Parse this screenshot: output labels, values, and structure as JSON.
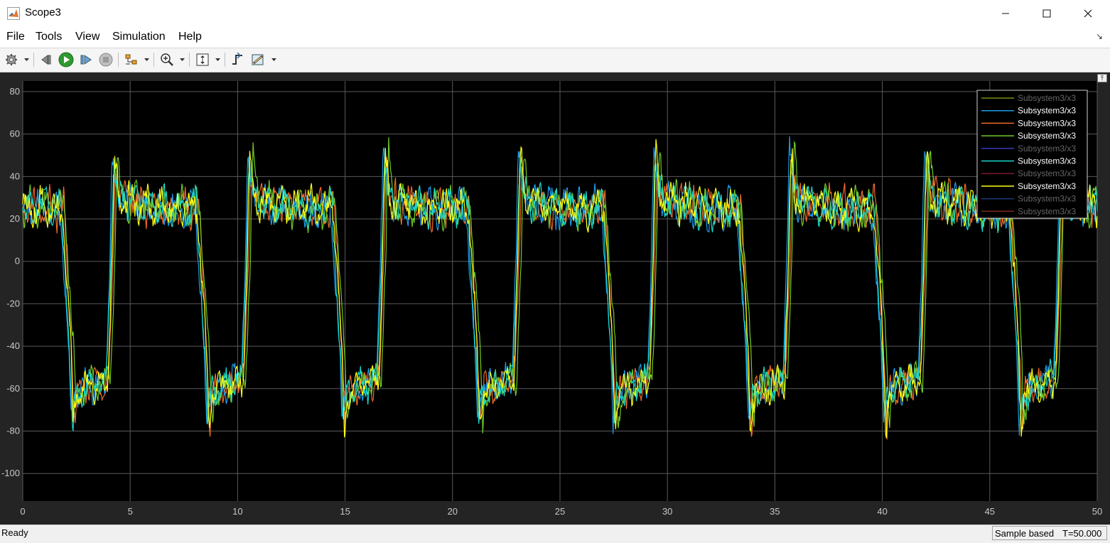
{
  "window": {
    "title": "Scope3"
  },
  "menu": [
    "File",
    "Tools",
    "View",
    "Simulation",
    "Help"
  ],
  "toolbar": {
    "icons": [
      "gear-icon",
      "step-back-icon",
      "run-icon",
      "step-forward-icon",
      "stop-icon",
      "signal-select-icon",
      "zoom-in-icon",
      "autoscale-icon",
      "trigger-icon",
      "measurements-icon"
    ]
  },
  "status": {
    "ready": "Ready",
    "mode": "Sample based",
    "time": "T=50.000"
  },
  "colors": {
    "axes_bg": "#000000",
    "figure_bg": "#242424",
    "grid": "#5a5a5a",
    "tick_label": "#c8c8c8",
    "ch1": "#7a8a18",
    "ch2": "#1e9be8",
    "ch3": "#ee6a28",
    "ch4": "#6fcb2a",
    "ch5": "#3a3ab8",
    "ch6": "#18d8d0",
    "ch7": "#7a1a2a",
    "ch8": "#ffff10",
    "ch9": "#1a3a7a",
    "ch10": "#7a2a1a"
  },
  "chart_data": {
    "type": "line",
    "title": "",
    "xlabel": "",
    "ylabel": "",
    "xlim": [
      0,
      50
    ],
    "ylim": [
      -113,
      85
    ],
    "xticks": [
      0,
      5,
      10,
      15,
      20,
      25,
      30,
      35,
      40,
      45,
      50
    ],
    "yticks": [
      80,
      60,
      40,
      20,
      0,
      -20,
      -40,
      -60,
      -80,
      -100
    ],
    "grid": true,
    "legend_position": "top-right",
    "legend": [
      {
        "label": "Subsystem3/x3",
        "color": "#7a8a18",
        "dim": true
      },
      {
        "label": "Subsystem3/x3",
        "color": "#1e9be8",
        "dim": false
      },
      {
        "label": "Subsystem3/x3",
        "color": "#ee6a28",
        "dim": false
      },
      {
        "label": "Subsystem3/x3",
        "color": "#6fcb2a",
        "dim": false
      },
      {
        "label": "Subsystem3/x3",
        "color": "#3a3ab8",
        "dim": true
      },
      {
        "label": "Subsystem3/x3",
        "color": "#18d8d0",
        "dim": false
      },
      {
        "label": "Subsystem3/x3",
        "color": "#7a1a2a",
        "dim": true
      },
      {
        "label": "Subsystem3/x3",
        "color": "#ffff10",
        "dim": false
      },
      {
        "label": "Subsystem3/x3",
        "color": "#1a3a7a",
        "dim": true
      },
      {
        "label": "Subsystem3/x3",
        "color": "#7a2a1a",
        "dim": true
      }
    ],
    "visible_series": [
      {
        "color": "#ee6a28",
        "seed": 3,
        "shift": 0.0
      },
      {
        "color": "#1e9be8",
        "seed": 7,
        "shift": 0.15
      },
      {
        "color": "#6fcb2a",
        "seed": 11,
        "shift": -0.08
      },
      {
        "color": "#18d8d0",
        "seed": 5,
        "shift": 0.1
      },
      {
        "color": "#ffff10",
        "seed": 13,
        "shift": 0.05
      }
    ],
    "envelope": {
      "period": 6.3,
      "cycle": [
        {
          "t": 0.0,
          "v": 25
        },
        {
          "t": 1.9,
          "v": 25
        },
        {
          "t": 2.4,
          "v": -62
        },
        {
          "t": 4.0,
          "v": -55
        },
        {
          "t": 4.3,
          "v": 30
        },
        {
          "t": 6.3,
          "v": 25
        }
      ],
      "noise_high": 9,
      "noise_low": 8,
      "spike_peak": 52,
      "dip_min": -78
    }
  }
}
